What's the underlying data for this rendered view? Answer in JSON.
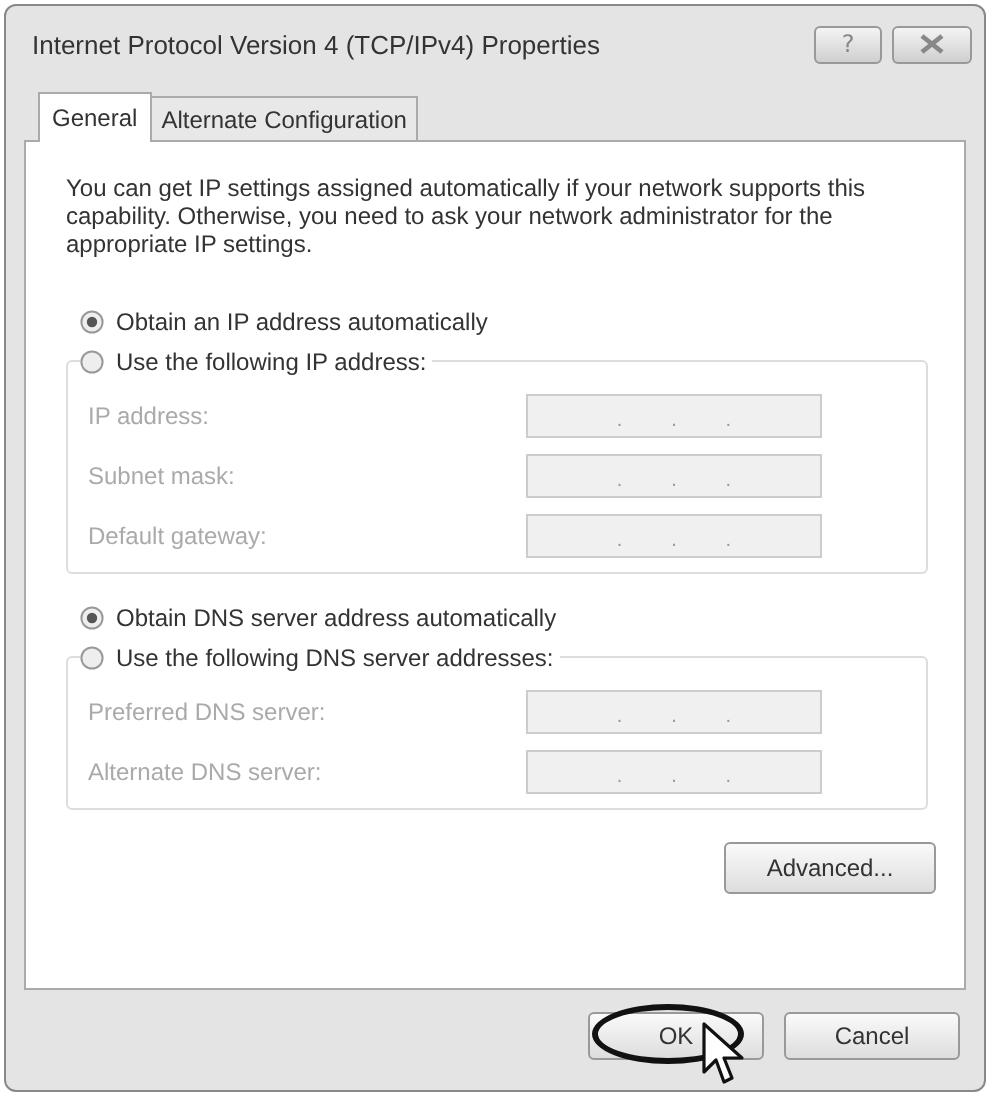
{
  "window": {
    "title": "Internet Protocol Version 4 (TCP/IPv4) Properties",
    "help_button": "?"
  },
  "tabs": [
    {
      "label": "General",
      "selected": true
    },
    {
      "label": "Alternate Configuration",
      "selected": false
    }
  ],
  "description": "You can get IP settings assigned automatically if your network supports this capability. Otherwise, you need to ask your network administrator for the appropriate IP settings.",
  "groups": [
    {
      "auto_option": {
        "label": "Obtain an IP address automatically",
        "selected": true
      },
      "manual_option": {
        "label": "Use the following IP address:",
        "selected": false
      },
      "fields": [
        {
          "label": "IP address:",
          "disabled": true,
          "separators": [
            ".",
            ".",
            "."
          ]
        },
        {
          "label": "Subnet mask:",
          "disabled": true,
          "separators": [
            ".",
            ".",
            "."
          ]
        },
        {
          "label": "Default gateway:",
          "disabled": true,
          "separators": [
            ".",
            ".",
            "."
          ]
        }
      ]
    },
    {
      "auto_option": {
        "label": "Obtain DNS server address automatically",
        "selected": true
      },
      "manual_option": {
        "label": "Use the following DNS server addresses:",
        "selected": false
      },
      "fields": [
        {
          "label": "Preferred DNS server:",
          "disabled": true,
          "separators": [
            ".",
            ".",
            "."
          ]
        },
        {
          "label": "Alternate DNS server:",
          "disabled": true,
          "separators": [
            ".",
            ".",
            "."
          ]
        }
      ]
    }
  ],
  "advanced_button": "Advanced...",
  "buttons": [
    {
      "label": "OK",
      "circled": true,
      "pointer": true
    },
    {
      "label": "Cancel",
      "circled": false,
      "pointer": false
    }
  ]
}
